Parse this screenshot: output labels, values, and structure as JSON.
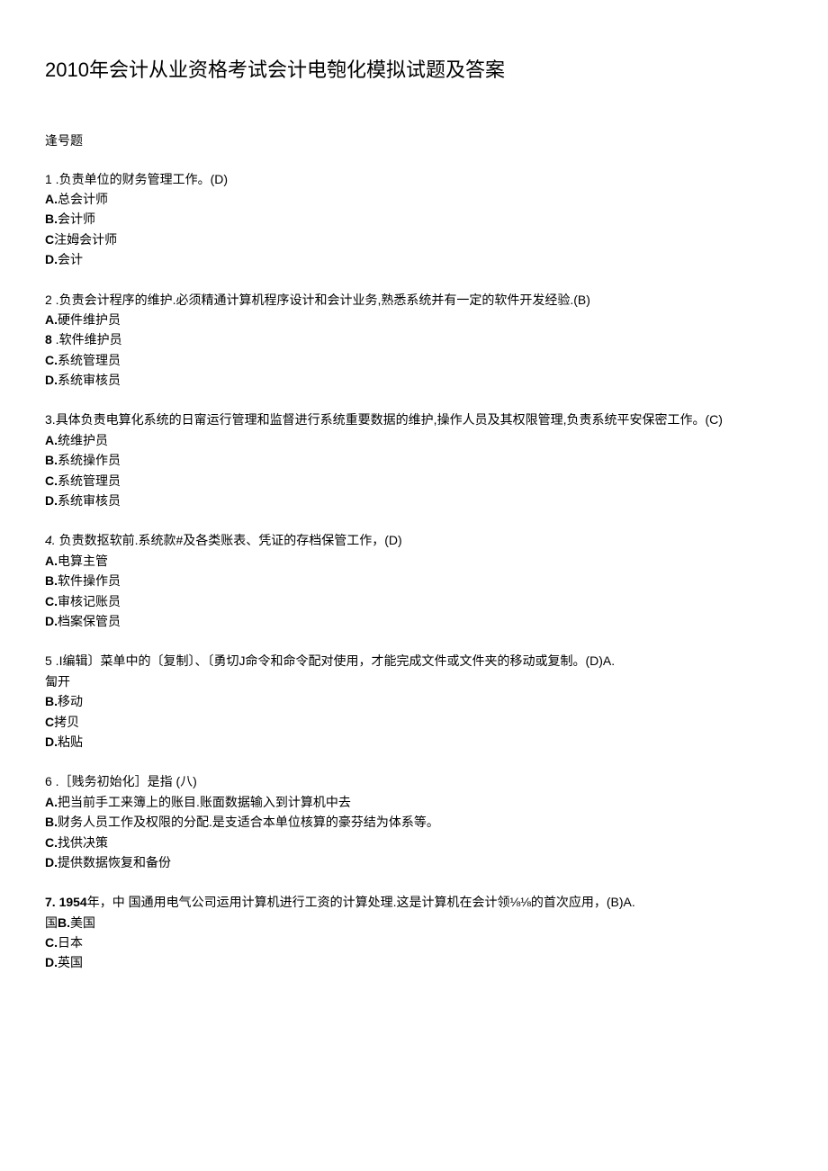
{
  "title": "2010年会计从业资格考试会计电匏化模拟试题及答案",
  "section_label": "逢号题",
  "questions": [
    {
      "num": "1",
      "sep": " .",
      "text": "负责单位的财务管理工作。(D)",
      "options": [
        {
          "label": "A.",
          "text": "总会计师"
        },
        {
          "label": "B.",
          "text": "会计师"
        },
        {
          "label": "C",
          "text": "注姆会计师"
        },
        {
          "label": "D.",
          "text": "会计"
        }
      ]
    },
    {
      "num": "2",
      "sep": "   .",
      "text": "负责会计程序的维护.必须精通计算机程序设计和会计业务,熟悉系统并有一定的软件开发经验.(B)",
      "options": [
        {
          "label": "A.",
          "text": "硬件维护员"
        },
        {
          "label": "8",
          "text": "   .软件维护员"
        },
        {
          "label": "C.",
          "text": "系统管理员"
        },
        {
          "label": "D.",
          "text": "系统审核员"
        }
      ]
    },
    {
      "num": "3.",
      "sep": "",
      "text": "具体负责电算化系统的日甯运行管理和监督进行系统重要数据的维护,操作人员及其权限管理,负责系统平安保密工作。(C)",
      "options": [
        {
          "label": "A.",
          "text": "统维护员"
        },
        {
          "label": "B.",
          "text": "系统操作员"
        },
        {
          "label": "C.",
          "text": "系统管理员"
        },
        {
          "label": "D.",
          "text": "系统审核员"
        }
      ]
    },
    {
      "num": "4.",
      "sep": " ",
      "text": "负责数抠软前.系统款#及各类账表、凭证的存档保管工作，(D)",
      "options": [
        {
          "label": "A.",
          "text": "电算主管"
        },
        {
          "label": "B.",
          "text": "软件操作员"
        },
        {
          "label": "C.",
          "text": "审核记账员"
        },
        {
          "label": "D.",
          "text": "档案保管员"
        }
      ]
    },
    {
      "num": "5",
      "sep": "   .I",
      "text": "编辑〕菜单中的〔复制〕、〔勇切J命令和命令配对使用，才能完成文件或文件夹的移动或复制。(D)A.",
      "trailing": "匐开",
      "options": [
        {
          "label": "B.",
          "text": "移动"
        },
        {
          "label": "C",
          "text": "拷贝"
        },
        {
          "label": "D.",
          "text": "粘贴"
        }
      ]
    },
    {
      "num": "6",
      "sep": "   .",
      "text": "［贱务初始化］是指  (八)",
      "options": [
        {
          "label": "A.",
          "text": "把当前手工来簿上的账目.账面数据输入到计算机中去"
        },
        {
          "label": "B.",
          "text": "财务人员工作及权限的分配.是支适合本单位核算的豪芬结为体系等。"
        },
        {
          "label": "C.",
          "text": "找供决策"
        },
        {
          "label": "D.",
          "text": "提供数据恢复和备份"
        }
      ]
    }
  ],
  "q7": {
    "num": "7.",
    "left1": "1954",
    "left_suffix": "年，中",
    "right1": "   国通用电气公司运用计算机进行工资的计算处理.这是计算机在会计领⅛⅛的首次应用，(B)A.",
    "left2": "国",
    "right2": "B.",
    "right2b": "美国",
    "options": [
      {
        "label": "C.",
        "text": "日本"
      },
      {
        "label": "D.",
        "text": "英国"
      }
    ]
  }
}
